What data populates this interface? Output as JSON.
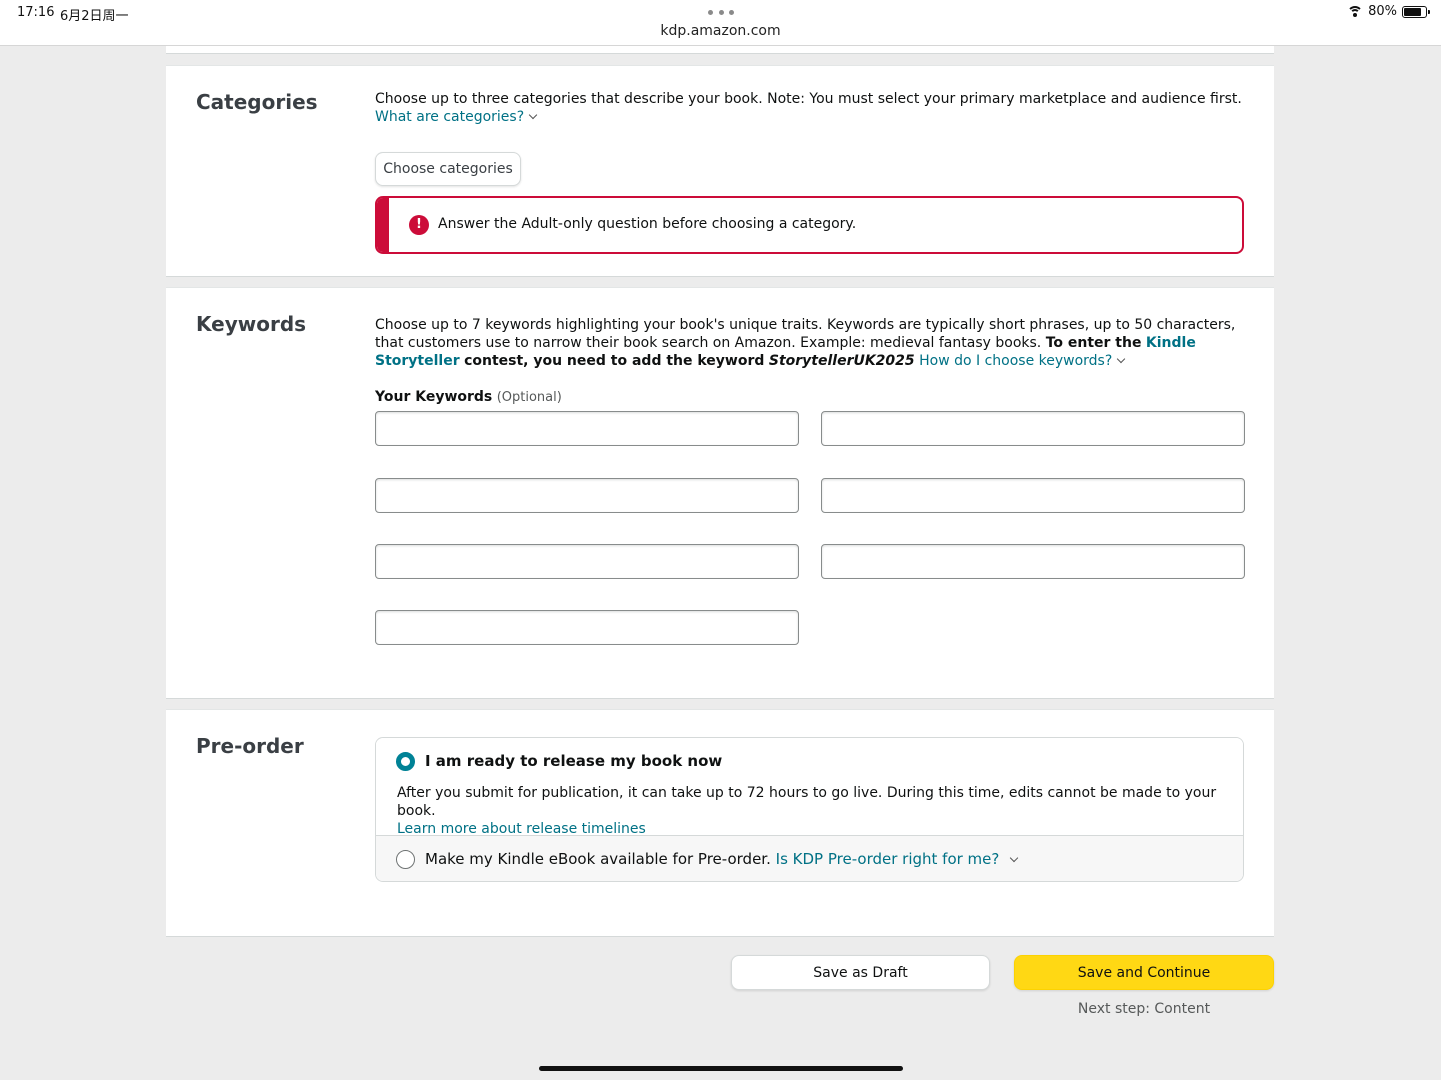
{
  "status_bar": {
    "time": "17:16",
    "date": "6月2日周一",
    "url": "kdp.amazon.com",
    "battery": "80%"
  },
  "categories": {
    "title": "Categories",
    "description": "Choose up to three categories that describe your book. Note: You must select your primary marketplace and audience first.",
    "help_link": "What are categories?",
    "choose_button": "Choose categories",
    "error_message": "Answer the Adult-only question before choosing a category."
  },
  "keywords": {
    "title": "Keywords",
    "desc_part1": "Choose up to 7 keywords highlighting your book's unique traits. Keywords are typically short phrases, up to 50 characters, that customers use to narrow their book search on Amazon. Example: medieval fantasy books.",
    "desc_bold1": "To enter the",
    "contest_link": "Kindle Storyteller",
    "desc_bold2": "contest, you need to add the keyword",
    "keyword_italic": "StorytellerUK2025",
    "help_link": "How do I choose keywords?",
    "label": "Your Keywords",
    "optional": "(Optional)",
    "inputs": [
      "",
      "",
      "",
      "",
      "",
      "",
      ""
    ]
  },
  "preorder": {
    "title": "Pre-order",
    "option1_label": "I am ready to release my book now",
    "option1_text": "After you submit for publication, it can take up to 72 hours to go live. During this time, edits cannot be made to your book.",
    "option1_link": "Learn more about release timelines",
    "option2_label": "Make my Kindle eBook available for Pre-order.",
    "option2_link": "Is KDP Pre-order right for me?",
    "selected": "option1"
  },
  "footer": {
    "draft_button": "Save as Draft",
    "continue_button": "Save and Continue",
    "next_step": "Next step: Content"
  },
  "colors": {
    "link": "#007185",
    "error": "#cc0c39",
    "primary_button": "#ffd814",
    "radio_selected": "#008296"
  }
}
